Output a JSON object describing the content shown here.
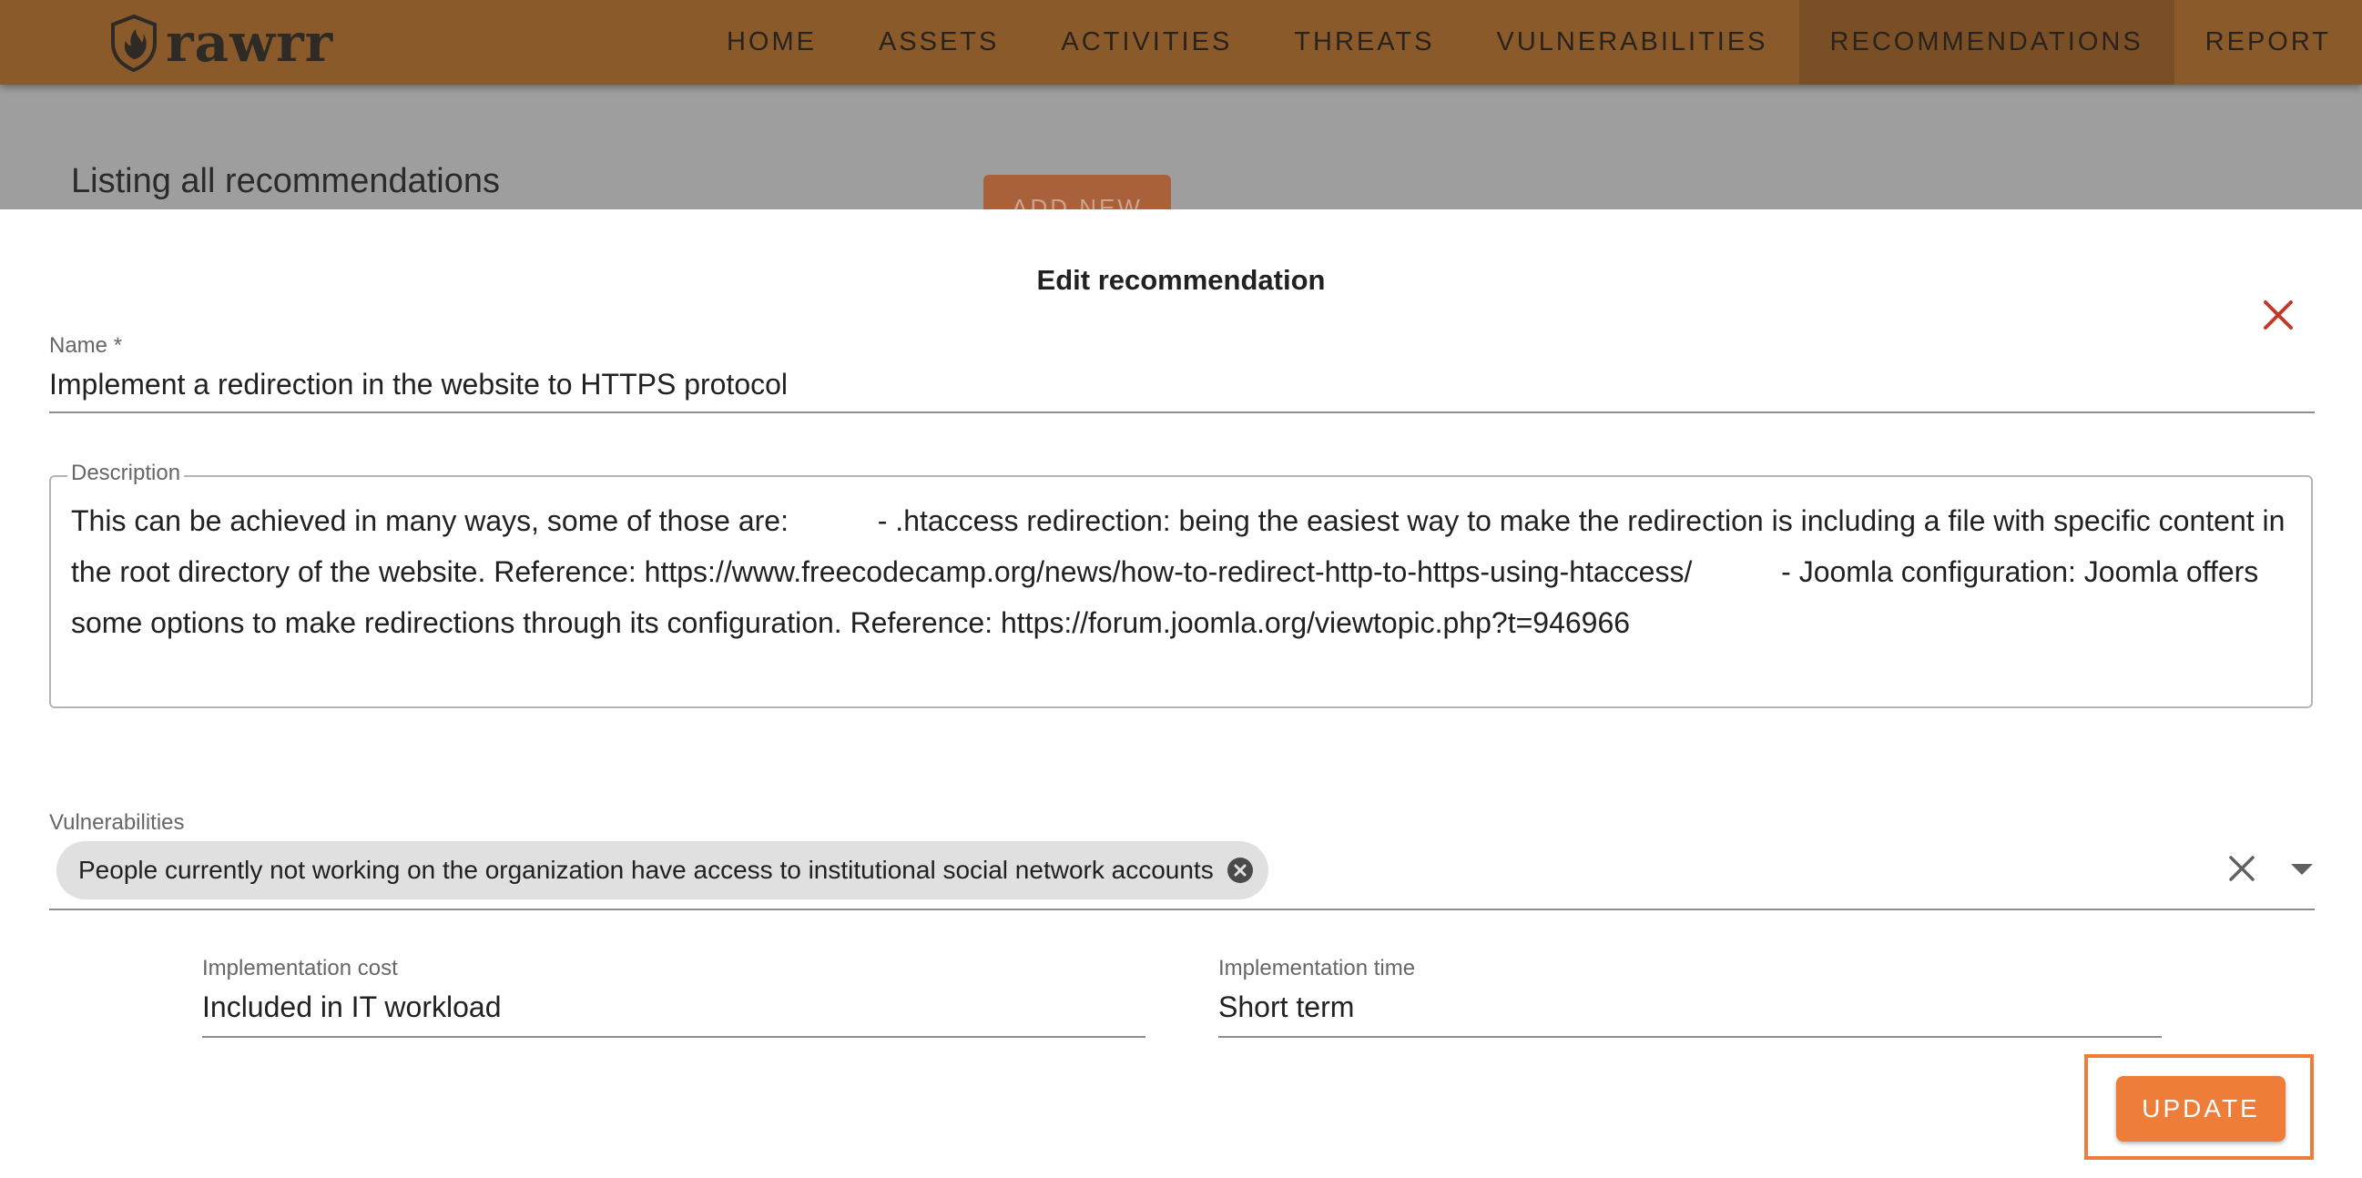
{
  "app": {
    "logo_text": "rawrr",
    "logo_icon": "shield-flame-icon"
  },
  "nav": {
    "items": [
      {
        "label": "HOME"
      },
      {
        "label": "ASSETS"
      },
      {
        "label": "ACTIVITIES"
      },
      {
        "label": "THREATS"
      },
      {
        "label": "VULNERABILITIES"
      },
      {
        "label": "RECOMMENDATIONS",
        "active": true
      },
      {
        "label": "REPORT"
      }
    ]
  },
  "page": {
    "title": "Listing all recommendations",
    "add_button_label": "ADD NEW"
  },
  "modal": {
    "title": "Edit recommendation",
    "close_icon": "close-icon",
    "name": {
      "label": "Name *",
      "value": "Implement a redirection in the website to HTTPS protocol"
    },
    "description": {
      "label": "Description",
      "value": "This can be achieved in many ways, some of those are:           - .htaccess redirection: being the easiest way to make the redirection is including a file with specific content in the root directory of the website. Reference: https://www.freecodecamp.org/news/how-to-redirect-http-to-https-using-htaccess/           - Joomla configuration: Joomla offers some options to make redirections through its configuration. Reference: https://forum.joomla.org/viewtopic.php?t=946966"
    },
    "vulnerabilities": {
      "label": "Vulnerabilities",
      "selected": [
        "People currently not working on the organization have access to institutional social network accounts"
      ]
    },
    "implementation_cost": {
      "label": "Implementation cost",
      "value": "Included in IT workload"
    },
    "implementation_time": {
      "label": "Implementation time",
      "value": "Short term"
    },
    "update_button_label": "UPDATE"
  },
  "colors": {
    "navbar": "#8a5a2b",
    "accent": "#ef7d3a",
    "close": "#c0392b"
  }
}
